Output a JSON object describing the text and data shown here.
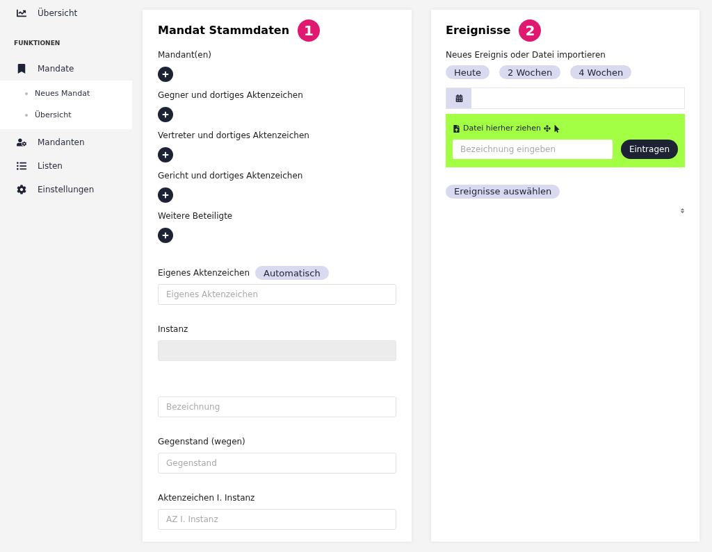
{
  "sidebar": {
    "top_item": {
      "label": "Übersicht"
    },
    "section_title": "FUNKTIONEN",
    "items": [
      {
        "label": "Mandate",
        "children": [
          {
            "label": "Neues Mandat"
          },
          {
            "label": "Übersicht"
          }
        ]
      },
      {
        "label": "Mandanten"
      },
      {
        "label": "Listen"
      },
      {
        "label": "Einstellungen"
      }
    ]
  },
  "stammdaten": {
    "title": "Mandat Stammdaten",
    "badge": "1",
    "add_sections": [
      {
        "label": "Mandant(en)"
      },
      {
        "label": "Gegner und dortiges Aktenzeichen"
      },
      {
        "label": "Vertreter und dortiges Aktenzeichen"
      },
      {
        "label": "Gericht und dortiges Aktenzeichen"
      },
      {
        "label": "Weitere Beteiligte"
      }
    ],
    "fields": [
      {
        "label": "Eigenes Aktenzeichen",
        "tag": "Automatisch",
        "placeholder": "Eigenes Aktenzeichen",
        "disabled": false
      },
      {
        "label": "Instanz",
        "disabled": true
      },
      {
        "placeholder": "Bezeichnung",
        "disabled": false
      },
      {
        "label": "Gegenstand (wegen)",
        "placeholder": "Gegenstand",
        "disabled": false
      },
      {
        "label": "Aktenzeichen I. Instanz",
        "placeholder": "AZ I. Instanz",
        "disabled": false
      }
    ]
  },
  "ereignisse": {
    "title": "Ereignisse",
    "badge": "2",
    "subtitle": "Neues Ereignis oder Datei importieren",
    "quick_buttons": [
      "Heute",
      "2 Wochen",
      "4 Wochen"
    ],
    "dropzone": {
      "text": "Datei hierher ziehen",
      "placeholder": "Bezeichnung eingeben",
      "button": "Eintragen"
    },
    "select_button": "Ereignisse auswählen"
  }
}
